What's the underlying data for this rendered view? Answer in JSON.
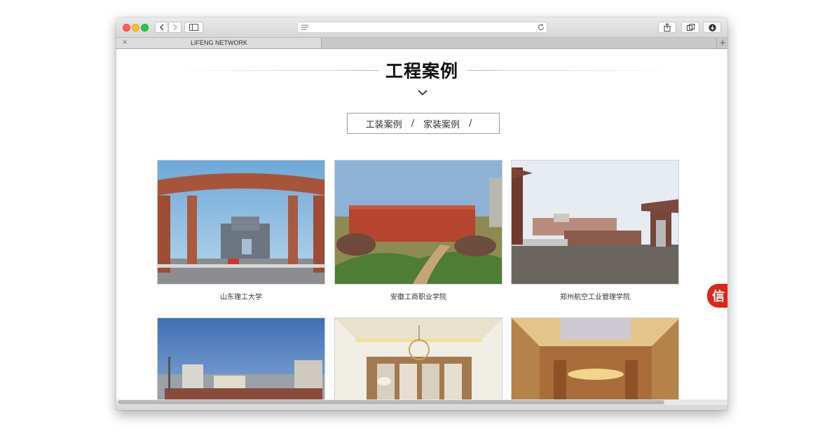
{
  "browser": {
    "address_value": "",
    "tab_title": "LIFENG NETWORK",
    "tab_close": "×",
    "new_tab": "+"
  },
  "page": {
    "heading": "工程案例",
    "filters": [
      "工装案例",
      "家装案例"
    ],
    "separator": "/",
    "cases": [
      {
        "caption": "山东理工大学"
      },
      {
        "caption": "安徽工商职业学院"
      },
      {
        "caption": "郑州航空工业管理学院"
      },
      {
        "caption": ""
      },
      {
        "caption": ""
      },
      {
        "caption": ""
      }
    ],
    "chat_badge": "信"
  },
  "colors": {
    "accent_red": "#e0251b",
    "heading": "#111111",
    "text": "#333333"
  }
}
